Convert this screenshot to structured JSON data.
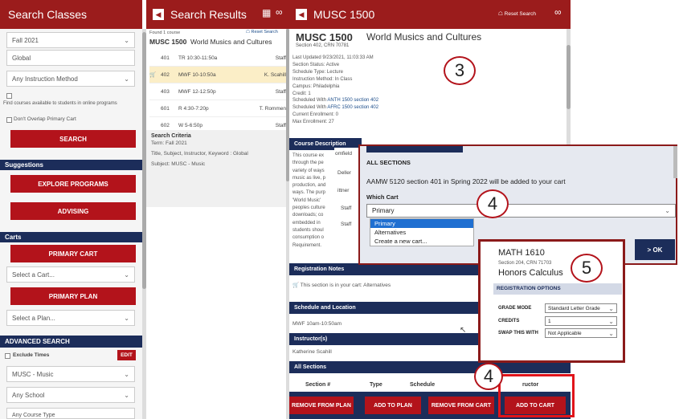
{
  "search_classes": {
    "title": "Search Classes",
    "term": "Fall 2021",
    "campus": "Global",
    "method": "Any Instruction Method",
    "online_text": "Find courses available to students in online programs",
    "no_overlap": "Don't Overlap Primary Cart",
    "search_btn": "SEARCH",
    "suggestions_header": "Suggestions",
    "explore_btn": "EXPLORE PROGRAMS",
    "advising_btn": "ADVISING",
    "carts_header": "Carts",
    "primary_cart_btn": "PRIMARY CART",
    "select_cart": "Select a Cart...",
    "primary_plan_btn": "PRIMARY PLAN",
    "select_plan": "Select a Plan...",
    "advanced_header": "ADVANCED SEARCH",
    "exclude_times": "Exclude Times",
    "edit_btn": "EDIT",
    "subject": "MUSC - Music",
    "school": "Any School",
    "more": "Any Course Type"
  },
  "results": {
    "title": "Search Results",
    "found": "Found 1 course",
    "reset": "Reset Search",
    "course_code": "MUSC 1500",
    "course_title": "World Musics and Cultures",
    "sections": [
      {
        "num": "401",
        "time": "TR 10:30-11:50a",
        "instr": "Staff"
      },
      {
        "num": "402",
        "time": "MWF 10-10:50a",
        "instr": "K. Scahill"
      },
      {
        "num": "403",
        "time": "MWF 12-12:50p",
        "instr": "Staff"
      },
      {
        "num": "601",
        "time": "R 4:30-7:20p",
        "instr": "T. Rommen"
      },
      {
        "num": "602",
        "time": "W 5-6:50p",
        "instr": "Staff"
      }
    ],
    "criteria_header": "Search Criteria",
    "criteria": [
      "Term: Fall 2021",
      "Title, Subject, Instructor, Keyword : Global",
      "Subject: MUSC - Music"
    ]
  },
  "detail": {
    "title": "MUSC 1500",
    "reset": "Reset Search",
    "code": "MUSC 1500",
    "name": "World Musics and Cultures",
    "section": "Section 402, CRN 70781",
    "info": [
      "Last Updated 9/23/2021, 11:03:33 AM",
      "Section Status: Active",
      "Schedule Type: Lecture",
      "Instruction Method: In Class",
      "Campus: Philadelphia",
      "Credit: 1"
    ],
    "sched1_prefix": "Scheduled With ",
    "sched1_link": "ANTH 1500 section 402",
    "sched2_prefix": "Scheduled With ",
    "sched2_link": "AFRC 1500 section 402",
    "enrollment": "Current Enrollment: 0",
    "max_enrollment": "Max Enrollment: 27",
    "desc_header": "Course Description",
    "desc_lines": [
      "This course ex",
      "through the pe",
      "variety of ways",
      "music as live, p",
      "production, and",
      "ways. The purp",
      "'World Music'",
      "peoples culture",
      "downloads; co",
      "embedded in",
      "students shoul",
      "consumption o",
      "Requirement."
    ],
    "side_names": [
      "omfield",
      "Deller",
      "ittner",
      "Staff",
      "Staff"
    ],
    "notes_header": "Registration Notes",
    "notes_text": "This section is in your cart: Alternatives",
    "schedloc_header": "Schedule and Location",
    "schedloc": "MWF 10am-10:50am",
    "instructor_header": "Instructor(s)",
    "instructor": "Katherine Scahill",
    "all_sections_header": "All Sections",
    "col_section": "Section #",
    "col_type": "Type",
    "col_schedule": "Schedule",
    "col_instructor": "ructor",
    "btn_remove_plan": "REMOVE FROM PLAN",
    "btn_add_plan": "ADD TO PLAN",
    "btn_remove_cart": "REMOVE FROM CART",
    "btn_add_cart": "ADD TO CART"
  },
  "popup_cart": {
    "header": "ALL SECTIONS",
    "message": "AAMW 5120 section 401 in Spring 2022 will be added to your cart",
    "which_cart": "Which Cart",
    "selected": "Primary",
    "options": [
      "Primary",
      "Alternatives",
      "Create a new cart..."
    ],
    "ok": "OK"
  },
  "popup_math": {
    "code": "MATH 1610",
    "section": "Section 204, CRN 71703",
    "name": "Honors Calculus",
    "reg_header": "REGISTRATION OPTIONS",
    "grade_label": "GRADE MODE",
    "grade_value": "Standard Letter Grade",
    "credits_label": "CREDITS",
    "credits_value": "1",
    "swap_label": "SWAP THIS WITH",
    "swap_value": "Not Applicable"
  },
  "annotations": {
    "a3": "3",
    "a4a": "4",
    "a5": "5",
    "a4b": "4"
  },
  "colors": {
    "crimson": "#9b1c1c",
    "navy": "#1c2d5a",
    "button_red": "#b3131b",
    "highlight": "#fbeec7"
  },
  "icons": [
    "chevron-left-icon",
    "calendar-icon",
    "link-icon",
    "home-icon",
    "cart-icon",
    "chevron-down-icon"
  ]
}
